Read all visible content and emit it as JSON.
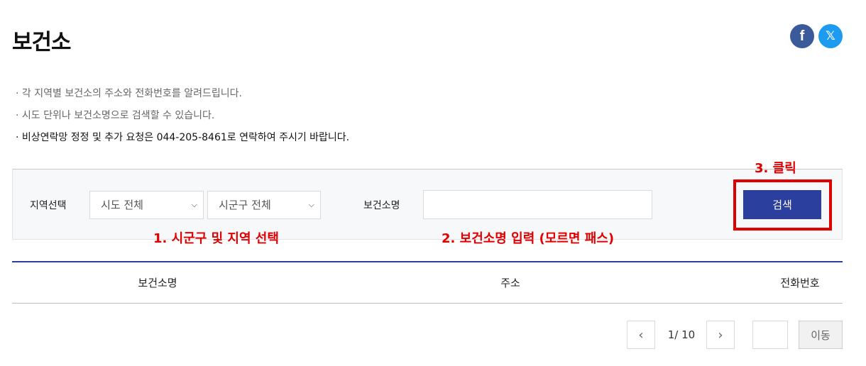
{
  "page": {
    "title": "보건소"
  },
  "share": {
    "facebook": "f",
    "x": "𝕏"
  },
  "notes": [
    "· 각 지역별 보건소의 주소와 전화번호를 알려드립니다.",
    "· 시도 단위나 보건소명으로 검색할 수 있습니다.",
    "· 비상연락망 정정 및 추가 요청은 044-205-8461로 연락하여 주시기 바랍니다."
  ],
  "search": {
    "region_label": "지역선택",
    "sido_value": "시도 전체",
    "sigungu_value": "시군구 전체",
    "name_label": "보건소명",
    "name_value": "",
    "button_label": "검색"
  },
  "annotations": {
    "step1": "1. 시군구 및 지역 선택",
    "step2": "2. 보건소명 입력 (모르면 패스)",
    "step3": "3. 클릭",
    "color": "#e00000"
  },
  "table": {
    "headers": [
      "보건소명",
      "주소",
      "전화번호"
    ]
  },
  "pagination": {
    "current": "1",
    "info": "1/ 10",
    "page_input": "",
    "go_label": "이동"
  },
  "colors": {
    "accent": "#2b3f9e",
    "facebook": "#3a5a99",
    "x": "#1d9bf0"
  }
}
